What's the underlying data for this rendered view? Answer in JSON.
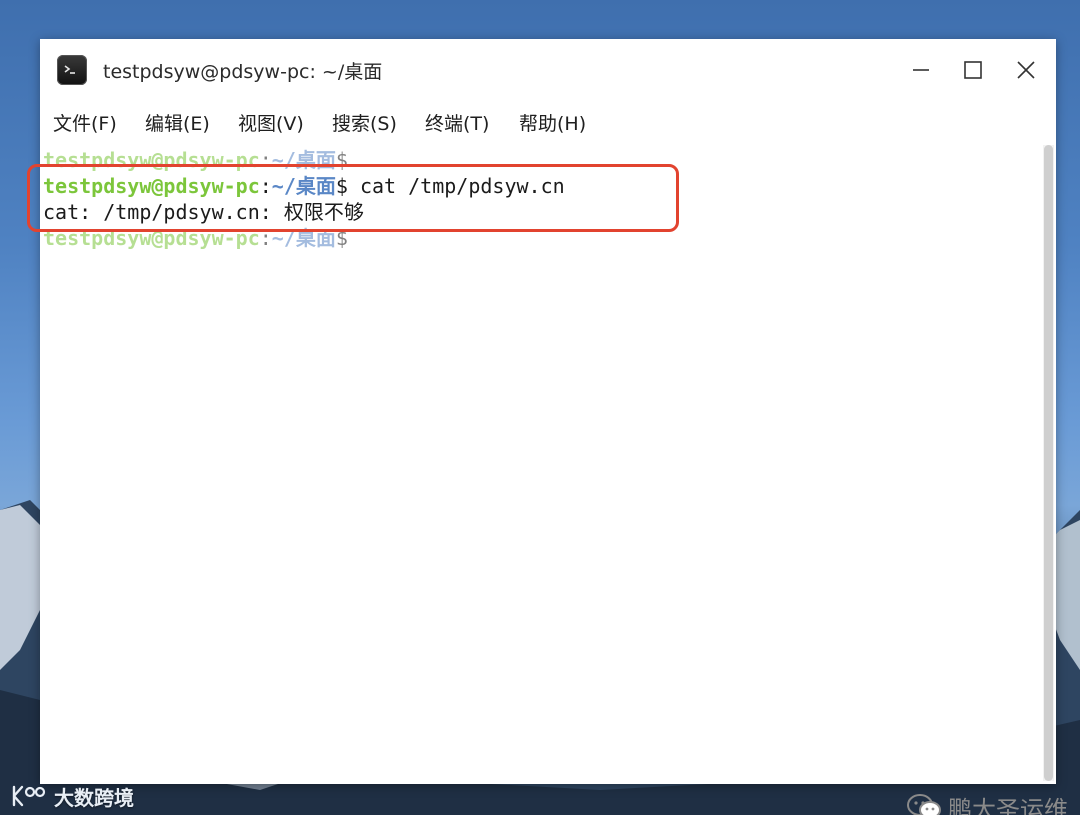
{
  "window": {
    "title": "testpdsyw@pdsyw-pc: ~/桌面"
  },
  "menu": {
    "items": [
      {
        "label": "文件(F)"
      },
      {
        "label": "编辑(E)"
      },
      {
        "label": "视图(V)"
      },
      {
        "label": "搜索(S)"
      },
      {
        "label": "终端(T)"
      },
      {
        "label": "帮助(H)"
      }
    ]
  },
  "terminal": {
    "lines": [
      {
        "user": "testpdsyw@pdsyw-pc",
        "sep": ":",
        "path": "~/桌面",
        "prompt": "$",
        "command": ""
      },
      {
        "user": "testpdsyw@pdsyw-pc",
        "sep": ":",
        "path": "~/桌面",
        "prompt": "$",
        "command": " cat /tmp/pdsyw.cn"
      },
      {
        "output": "cat: /tmp/pdsyw.cn: 权限不够"
      },
      {
        "user": "testpdsyw@pdsyw-pc",
        "sep": ":",
        "path": "~/桌面",
        "prompt": "$",
        "command": ""
      }
    ]
  },
  "watermarks": {
    "right": "鹏大圣运维",
    "left": "大数跨境"
  },
  "colors": {
    "user": "#7cc63b",
    "path": "#5a87c6",
    "highlight": "#e2432f"
  }
}
